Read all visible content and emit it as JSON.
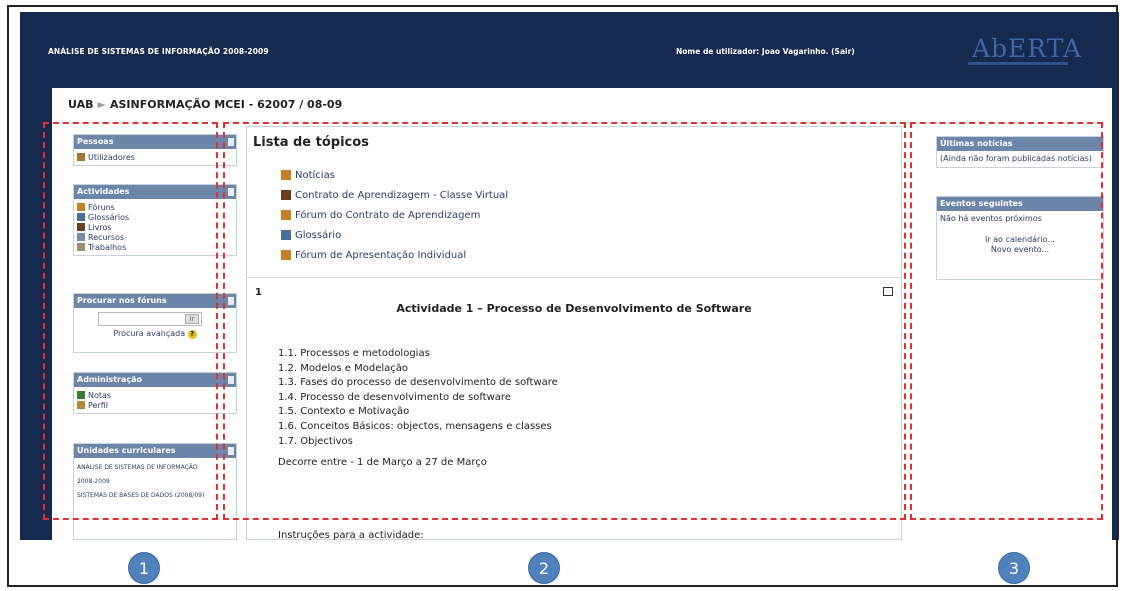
{
  "header": {
    "course_title": "ANÁLISE DE SISTEMAS DE INFORMAÇÃO 2008-2009",
    "user_info": "Nome de utilizador: Joao Vagarinho. (Sair)",
    "logo_text": "AbERTA"
  },
  "breadcrumb": {
    "root": "UAB",
    "separator": "►",
    "current": "ASINFORMAÇÃO MCEI - 62007 / 08-09"
  },
  "left": {
    "people": {
      "title": "Pessoas",
      "items": [
        "Utilizadores"
      ]
    },
    "activities": {
      "title": "Actividades",
      "items": [
        "Fóruns",
        "Glossários",
        "Livros",
        "Recursos",
        "Trabalhos"
      ]
    },
    "search": {
      "title": "Procurar nos fóruns",
      "button": "Ir",
      "advanced": "Procura avançada",
      "help_glyph": "?"
    },
    "admin": {
      "title": "Administração",
      "items": [
        "Notas",
        "Perfil"
      ]
    },
    "units": {
      "title": "Unidades curriculares",
      "items": [
        "ANÁLISE DE SISTEMAS DE INFORMAÇÃO",
        "2008-2009",
        "SISTEMAS DE BASES DE DADOS (2008/09)"
      ]
    }
  },
  "center": {
    "title": "Lista de tópicos",
    "topics": [
      {
        "label": "Notícias",
        "icon": "forum-icon"
      },
      {
        "label": "Contrato de Aprendizagem - Classe Virtual",
        "icon": "book-icon"
      },
      {
        "label": "Fórum do Contrato de Aprendizagem",
        "icon": "forum-icon"
      },
      {
        "label": "Glossário",
        "icon": "glossary-icon"
      },
      {
        "label": "Fórum de Apresentação Individual",
        "icon": "forum-icon"
      }
    ],
    "section_number": "1",
    "section_title": "Actividade 1 – Processo de Desenvolvimento de Software",
    "objectives": [
      "1.1. Processos e metodologias",
      "1.2. Modelos e Modelação",
      "1.3. Fases do processo de desenvolvimento de software",
      "1.4. Processo de desenvolvimento de software",
      "1.5. Contexto e Motivação",
      "1.6. Conceitos Básicos: objectos, mensagens e classes",
      "1.7. Objectivos"
    ],
    "period": "Decorre entre - 1 de Março a 27 de Março",
    "instructions": "Instruções para a actividade:"
  },
  "right": {
    "news": {
      "title": "Últimas notícias",
      "text": "(Ainda não foram publicadas notícias)"
    },
    "events": {
      "title": "Eventos seguintes",
      "text": "Não há eventos próximos",
      "calendar_link": "Ir ao calendário...",
      "new_event_link": "Novo evento..."
    }
  },
  "callouts": [
    "1",
    "2",
    "3"
  ],
  "colors": {
    "header_bg": "#16294f",
    "block_header": "#6b86a8",
    "annotation": "#e03030",
    "callout": "#4f81bd"
  }
}
